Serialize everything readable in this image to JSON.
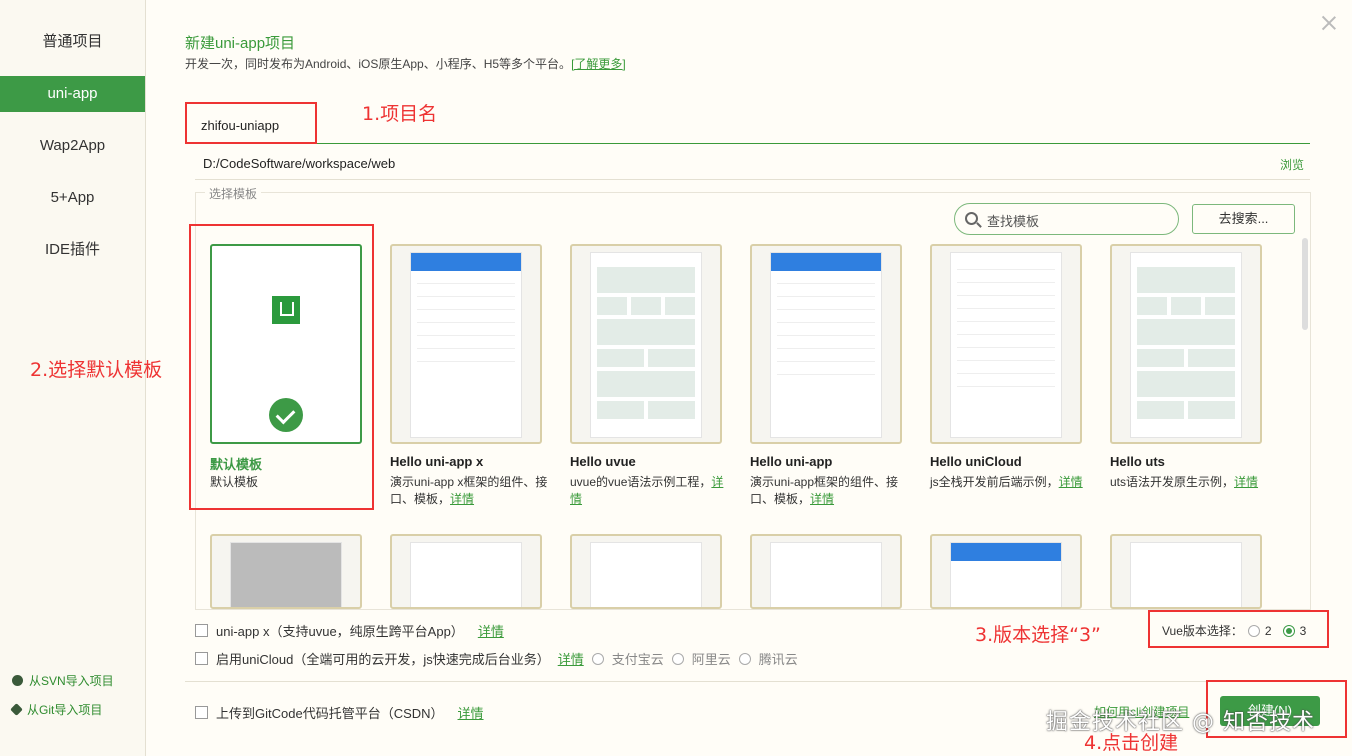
{
  "sidebar": {
    "items": [
      {
        "label": "普通项目",
        "active": false
      },
      {
        "label": "uni-app",
        "active": true
      },
      {
        "label": "Wap2App",
        "active": false
      },
      {
        "label": "5+App",
        "active": false
      },
      {
        "label": "IDE插件",
        "active": false
      }
    ],
    "import_svn": "从SVN导入项目",
    "import_git": "从Git导入项目"
  },
  "header": {
    "title": "新建uni-app项目",
    "subtitle": "开发一次，同时发布为Android、iOS原生App、小程序、H5等多个平台。",
    "learn_more": "[了解更多]"
  },
  "form": {
    "project_name": "zhifou-uniapp",
    "path": "D:/CodeSoftware/workspace/web",
    "browse": "浏览"
  },
  "templates": {
    "legend": "选择模板",
    "search_placeholder": "查找模板",
    "search_button": "去搜索...",
    "details_label": "详情",
    "cards": [
      {
        "title": "默认模板",
        "desc": "默认模板",
        "selected": true
      },
      {
        "title": "Hello uni-app x",
        "desc": "演示uni-app x框架的组件、接口、模板，"
      },
      {
        "title": "Hello uvue",
        "desc": "uvue的vue语法示例工程，"
      },
      {
        "title": "Hello uni-app",
        "desc": "演示uni-app框架的组件、接口、模板，"
      },
      {
        "title": "Hello uniCloud",
        "desc": "js全栈开发前后端示例，"
      },
      {
        "title": "Hello uts",
        "desc": "uts语法开发原生示例，"
      }
    ]
  },
  "options": {
    "uniappx_label": "uni-app x（支持uvue，纯原生跨平台App）",
    "unicloud_label": "启用uniCloud（全端可用的云开发，js快速完成后台业务）",
    "cloud_providers": [
      "支付宝云",
      "阿里云",
      "腾讯云"
    ],
    "gitcode_label": "上传到GitCode代码托管平台（CSDN）",
    "vue_version_label": "Vue版本选择：",
    "vue_versions": [
      "2",
      "3"
    ],
    "vue_selected": "3"
  },
  "footer": {
    "how_to": "如何用cli创建项目",
    "create_button": "创建(N)"
  },
  "annotations": {
    "step1": "1.项目名",
    "step2": "2.选择默认模板",
    "step3": "3.版本选择“3”",
    "step4": "4.点击创建",
    "watermark": "掘金技术社区 @ 知否技术"
  },
  "colors": {
    "accent": "#3d9a46",
    "annotation": "#ee3333"
  }
}
